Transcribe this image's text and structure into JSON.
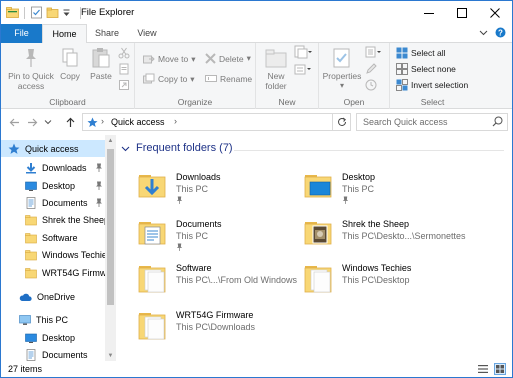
{
  "window": {
    "title": "File Explorer"
  },
  "title_controls": {
    "minimize": "—",
    "maximize": "☐",
    "close": "✕"
  },
  "tabs": [
    {
      "label": "File"
    },
    {
      "label": "Home"
    },
    {
      "label": "Share"
    },
    {
      "label": "View"
    }
  ],
  "ribbon": {
    "clipboard": {
      "label": "Clipboard",
      "pin_line1": "Pin to Quick",
      "pin_line2": "access",
      "copy": "Copy",
      "paste": "Paste"
    },
    "organize": {
      "label": "Organize",
      "move_to": "Move to",
      "copy_to": "Copy to",
      "delete": "Delete",
      "rename": "Rename"
    },
    "new": {
      "label": "New",
      "new_line1": "New",
      "new_line2": "folder"
    },
    "open": {
      "label": "Open",
      "properties": "Properties"
    },
    "select": {
      "label": "Select",
      "select_all": "Select all",
      "select_none": "Select none",
      "invert": "Invert selection"
    }
  },
  "address": {
    "path": "Quick access",
    "search_placeholder": "Search Quick access"
  },
  "nav": {
    "items": [
      {
        "label": "Quick access"
      },
      {
        "label": "Downloads"
      },
      {
        "label": "Desktop"
      },
      {
        "label": "Documents"
      },
      {
        "label": "Shrek the Sheep"
      },
      {
        "label": "Software"
      },
      {
        "label": "Windows Techies"
      },
      {
        "label": "WRT54G Firmwa"
      },
      {
        "label": "OneDrive"
      },
      {
        "label": "This PC"
      },
      {
        "label": "Desktop"
      },
      {
        "label": "Documents"
      }
    ]
  },
  "content": {
    "section_title": "Frequent folders (7)",
    "folders": [
      {
        "name": "Downloads",
        "path": "This PC"
      },
      {
        "name": "Desktop",
        "path": "This PC"
      },
      {
        "name": "Documents",
        "path": "This PC"
      },
      {
        "name": "Shrek the Sheep",
        "path": "This PC\\Deskto...\\Sermonettes"
      },
      {
        "name": "Software",
        "path": "This PC\\...\\From Old Windows"
      },
      {
        "name": "Windows Techies",
        "path": "This PC\\Desktop"
      },
      {
        "name": "WRT54G Firmware",
        "path": "This PC\\Downloads"
      }
    ]
  },
  "status": {
    "items_count": "27 items"
  },
  "colors": {
    "accent": "#1979ca",
    "selected": "#cce8ff",
    "folder": "#f8d775",
    "section_text": "#1e3287"
  }
}
